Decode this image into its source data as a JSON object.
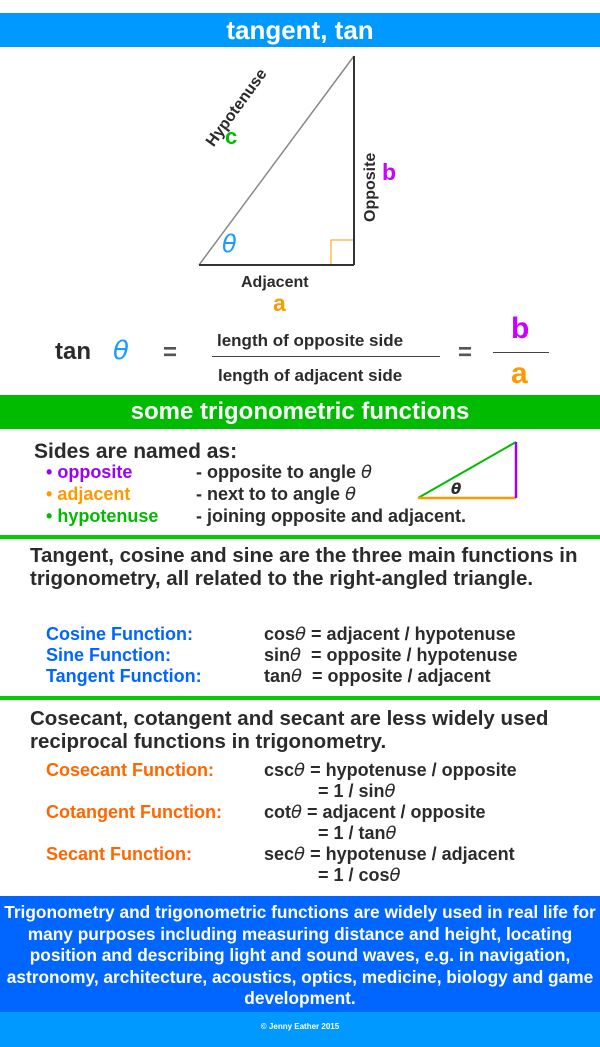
{
  "title": "tangent, tan",
  "diagram": {
    "hypotenuse_label": "Hypotenuse",
    "hypotenuse_letter": "c",
    "opposite_label": "Opposite",
    "opposite_letter": "b",
    "adjacent_label": "Adjacent",
    "adjacent_letter": "a",
    "angle_symbol": "θ"
  },
  "formula": {
    "lhs": "tan",
    "angle": "θ",
    "equals": "=",
    "numerator": "length of opposite side",
    "denominator": "length of adjacent side",
    "numerator_letter": "b",
    "denominator_letter": "a"
  },
  "section_title": "some trigonometric functions",
  "sides": {
    "heading": "Sides are named as:",
    "items": [
      {
        "bullet": "•",
        "name": "opposite",
        "desc": "- opposite to angle ",
        "theta": "θ",
        "color": "#9900ff"
      },
      {
        "bullet": "•",
        "name": "adjacent",
        "desc": "- next to to angle ",
        "theta": "θ",
        "color": "#ff9900"
      },
      {
        "bullet": "•",
        "name": "hypotenuse",
        "desc": "- joining opposite and adjacent.",
        "theta": "",
        "color": "#00bb00"
      }
    ],
    "mini_theta": "θ"
  },
  "main_functions": {
    "intro": "Tangent, cosine and sine are the three main functions in trigonometry, all related to the right-angled triangle.",
    "rows": [
      {
        "name": "Cosine Function:",
        "fn": "cos",
        "theta": "θ",
        "rhs": " = adjacent / hypotenuse"
      },
      {
        "name": "Sine Function:",
        "fn": "sin",
        "theta": "θ",
        "rhs": "  = opposite / hypotenuse"
      },
      {
        "name": "Tangent Function:",
        "fn": "tan",
        "theta": "θ",
        "rhs": "  = opposite / adjacent"
      }
    ]
  },
  "reciprocal_functions": {
    "intro": "Cosecant, cotangent and secant are less widely used reciprocal functions in trigonometry.",
    "rows": [
      {
        "name": "Cosecant Function:",
        "fn": "csc",
        "theta": "θ",
        "rhs": " = hypotenuse / opposite",
        "alt": "= 1 / sin",
        "alt_theta": "θ"
      },
      {
        "name": "Cotangent Function:",
        "fn": "cot",
        "theta": "θ",
        "rhs": " = adjacent / opposite",
        "alt": "= 1 / tan",
        "alt_theta": "θ"
      },
      {
        "name": "Secant Function:",
        "fn": "sec",
        "theta": "θ",
        "rhs": " = hypotenuse / adjacent",
        "alt": "= 1 / cos",
        "alt_theta": "θ"
      }
    ]
  },
  "info_box": "Trigonometry and trigonometric functions are widely used in real life for many purposes including measuring distance and height, locating position and describing light and sound waves, e.g. in navigation, astronomy, architecture, acoustics, optics, medicine, biology and game development.",
  "footer": "© Jenny Eather 2015",
  "colors": {
    "title_bar": "#0099ff",
    "section_bar": "#00bb00",
    "info_box": "#0066ff",
    "theta": "#1a9bff",
    "letter_a": "#ff9900",
    "letter_b": "#cc00ff",
    "letter_c": "#00bb00",
    "main_fn": "#0066ff",
    "reciprocal_fn": "#ff6600"
  }
}
